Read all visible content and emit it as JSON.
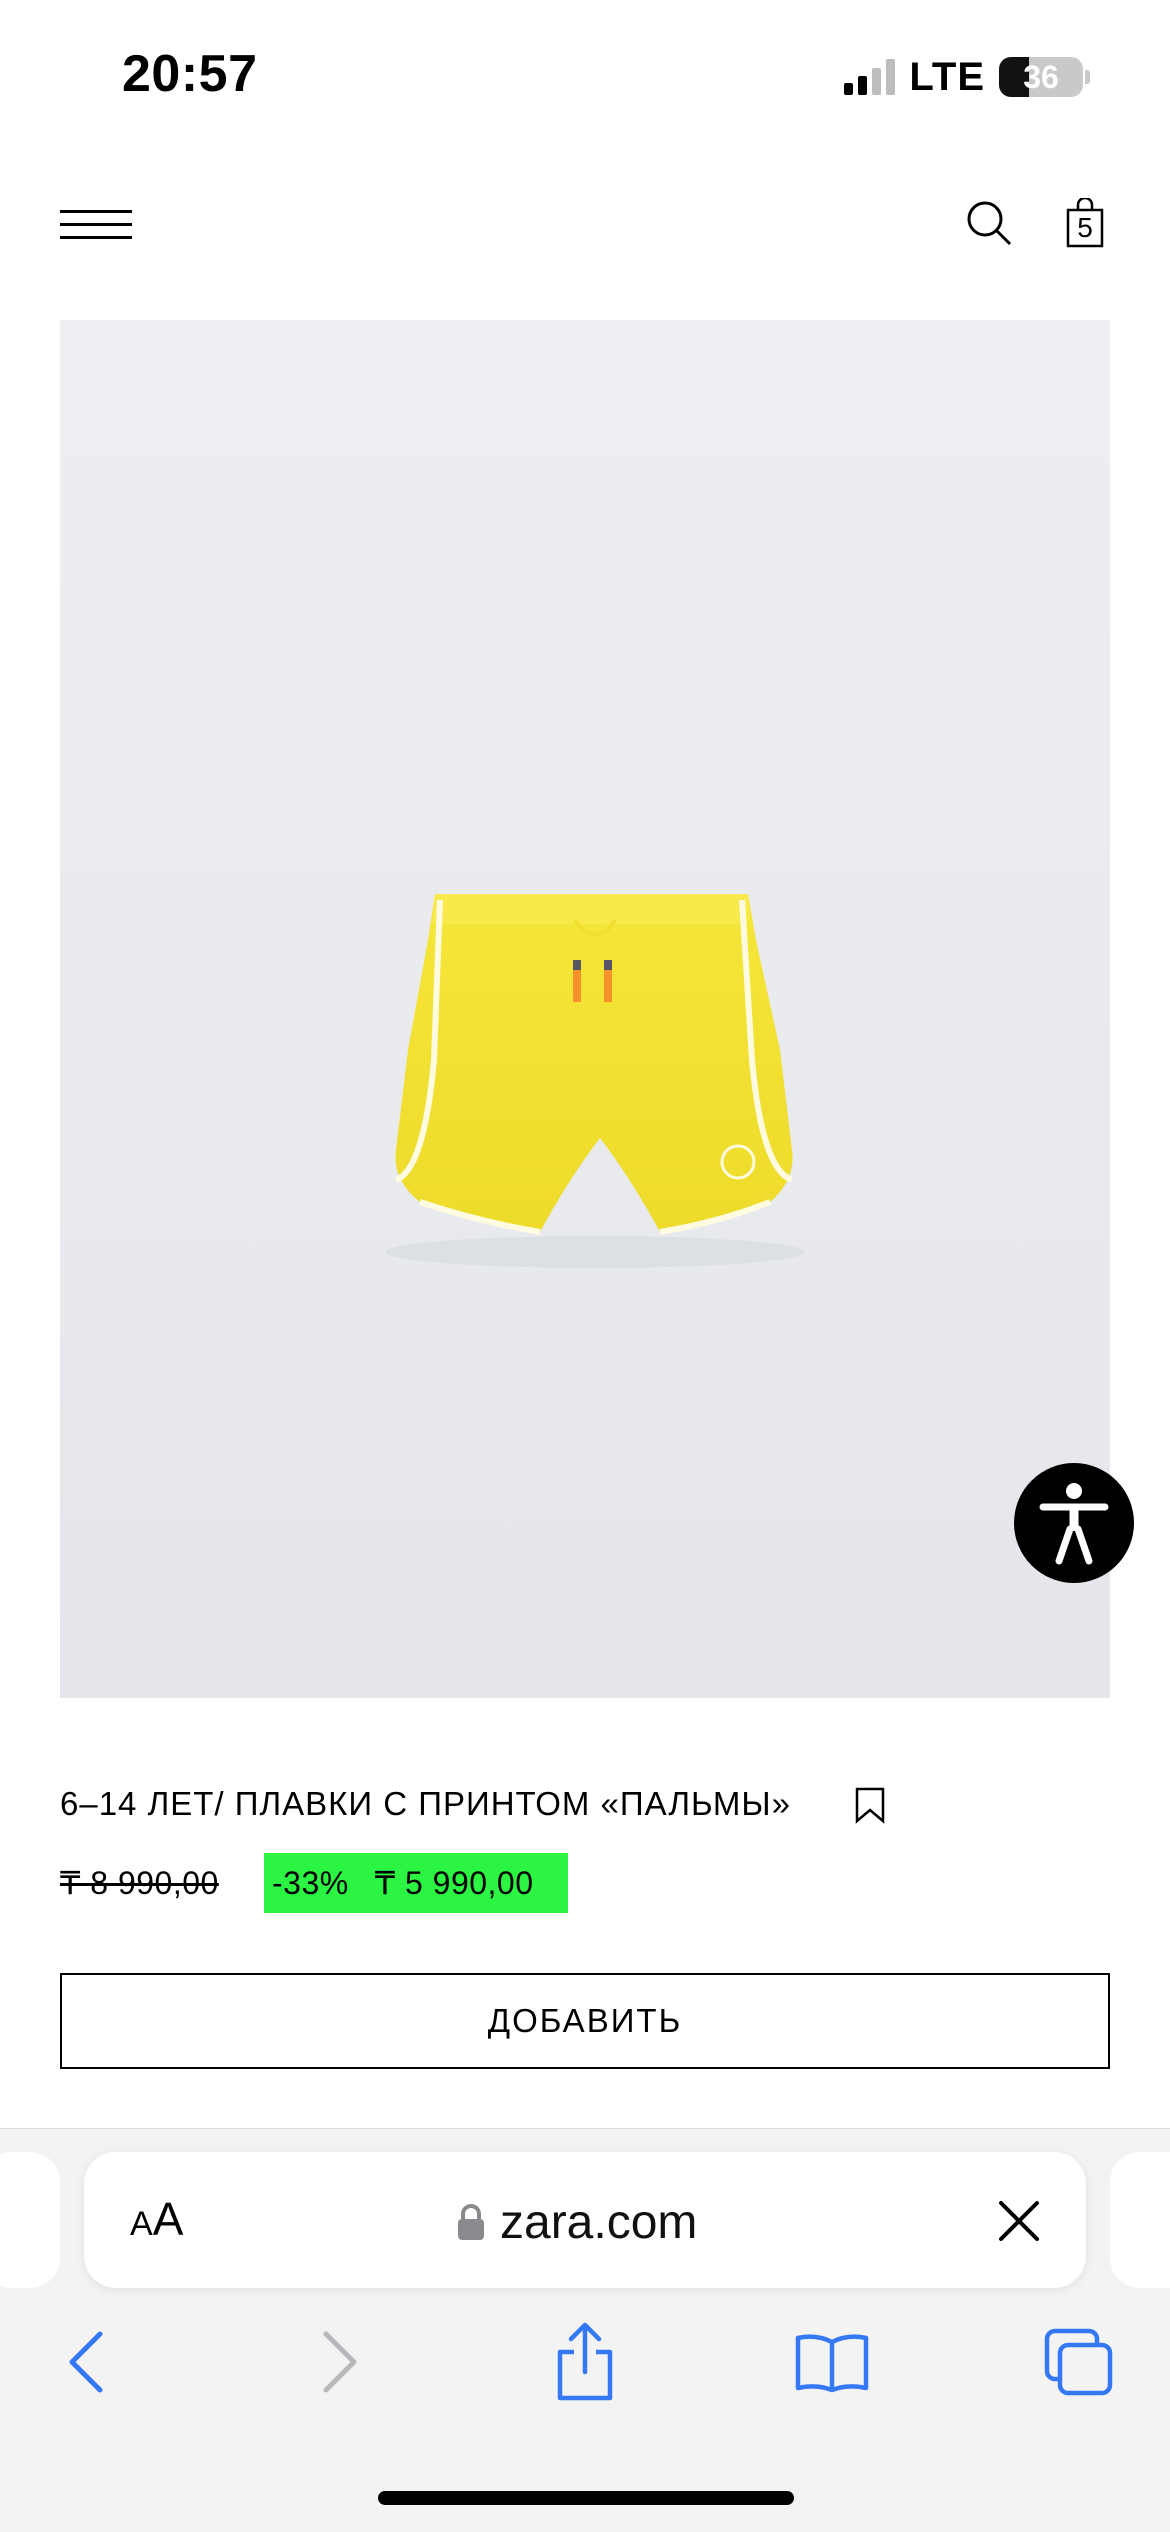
{
  "status_bar": {
    "time": "20:57",
    "network": "LTE",
    "battery_percent": "36",
    "signal_bars_active": 2,
    "signal_bars_total": 4
  },
  "header": {
    "menu_icon": "hamburger-menu-icon",
    "search_icon": "search-icon",
    "bag_icon": "shopping-bag-icon",
    "bag_count": "5"
  },
  "product": {
    "image_icon": "product-photo-yellow-swim-shorts",
    "title": "6–14 ЛЕТ/ ПЛАВКИ С ПРИНТОМ «ПАЛЬМЫ»",
    "bookmark_icon": "bookmark-icon",
    "old_price": "₸ 8 990,00",
    "discount": "-33%",
    "new_price": "₸ 5 990,00",
    "add_button_label": "ДОБАВИТЬ",
    "sale_color": "#2bf542"
  },
  "accessibility": {
    "icon": "accessibility-person-icon"
  },
  "safari": {
    "text_size_small": "A",
    "text_size_big": "A",
    "url": "zara.com",
    "lock_icon": "lock-icon",
    "close_icon": "close-icon",
    "toolbar": [
      "back-icon",
      "forward-icon",
      "share-icon",
      "bookmarks-icon",
      "tabs-icon"
    ],
    "accent_color": "#3478f6"
  }
}
